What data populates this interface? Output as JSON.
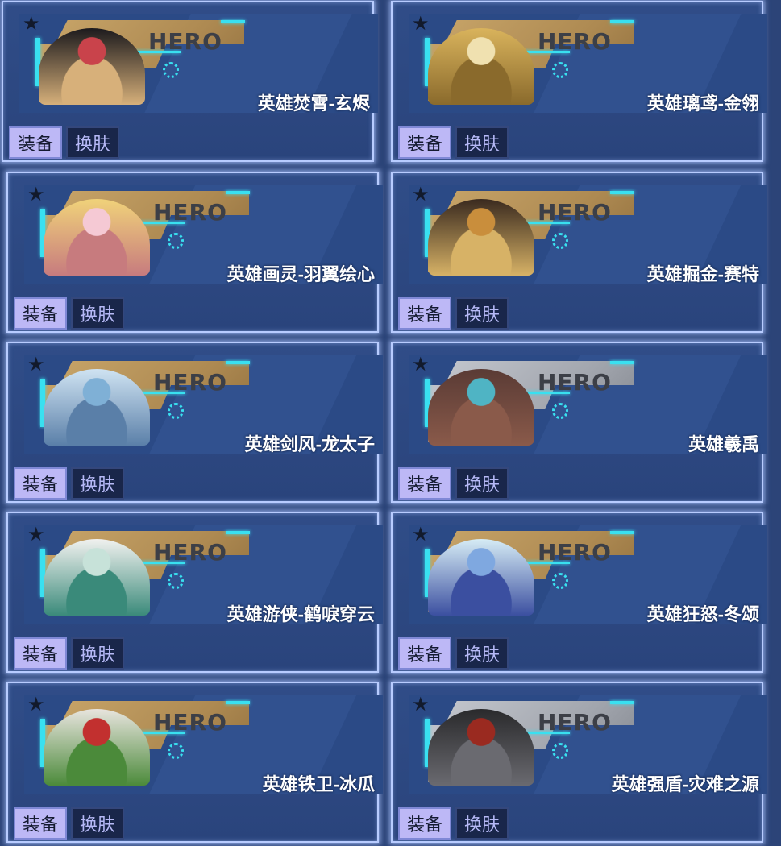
{
  "hero_cards": [
    {
      "name": "英雄焚霄-玄烬",
      "hero_word": "HERO",
      "equip_label": "装备",
      "skin_label": "换肤",
      "plate_color": "gold",
      "portrait_colors": [
        "#1c1a1d",
        "#c9434b",
        "#d7b07a"
      ]
    },
    {
      "name": "英雄璃鸢-金翎",
      "hero_word": "HERO",
      "equip_label": "装备",
      "skin_label": "换肤",
      "plate_color": "gold",
      "portrait_colors": [
        "#d9b35c",
        "#f0e1b0",
        "#8a6a2c"
      ]
    },
    {
      "name": "英雄画灵-羽翼绘心",
      "hero_word": "HERO",
      "equip_label": "装备",
      "skin_label": "换肤",
      "plate_color": "gold",
      "portrait_colors": [
        "#f0d27a",
        "#f5c9d4",
        "#c77b7e"
      ]
    },
    {
      "name": "英雄掘金-赛特",
      "hero_word": "HERO",
      "equip_label": "装备",
      "skin_label": "换肤",
      "plate_color": "gold",
      "portrait_colors": [
        "#3a2a1f",
        "#c98e3c",
        "#d7b266"
      ]
    },
    {
      "name": "英雄剑风-龙太子",
      "hero_word": "HERO",
      "equip_label": "装备",
      "skin_label": "换肤",
      "plate_color": "gold",
      "portrait_colors": [
        "#cfe3f2",
        "#7fb0d6",
        "#5a7fa8"
      ]
    },
    {
      "name": "英雄羲禹",
      "hero_word": "HERO",
      "equip_label": "装备",
      "skin_label": "换肤",
      "plate_color": "gray",
      "portrait_colors": [
        "#5a3b35",
        "#4fb4c4",
        "#8a5a4a"
      ]
    },
    {
      "name": "英雄游侠-鹤唳穿云",
      "hero_word": "HERO",
      "equip_label": "装备",
      "skin_label": "换肤",
      "plate_color": "gold",
      "portrait_colors": [
        "#f1f1ef",
        "#c7e2d9",
        "#3a8a7a"
      ]
    },
    {
      "name": "英雄狂怒-冬颂",
      "hero_word": "HERO",
      "equip_label": "装备",
      "skin_label": "换肤",
      "plate_color": "gold",
      "portrait_colors": [
        "#d6ecf5",
        "#7fa8e0",
        "#3b4fa0"
      ]
    },
    {
      "name": "英雄铁卫-冰瓜",
      "hero_word": "HERO",
      "equip_label": "装备",
      "skin_label": "换肤",
      "plate_color": "gold",
      "portrait_colors": [
        "#e8e4de",
        "#c2302f",
        "#4b8a3a"
      ]
    },
    {
      "name": "英雄强盾-灾难之源",
      "hero_word": "HERO",
      "equip_label": "装备",
      "skin_label": "换肤",
      "plate_color": "gray",
      "portrait_colors": [
        "#2a2a2c",
        "#9a2a20",
        "#6a6a70"
      ]
    }
  ]
}
